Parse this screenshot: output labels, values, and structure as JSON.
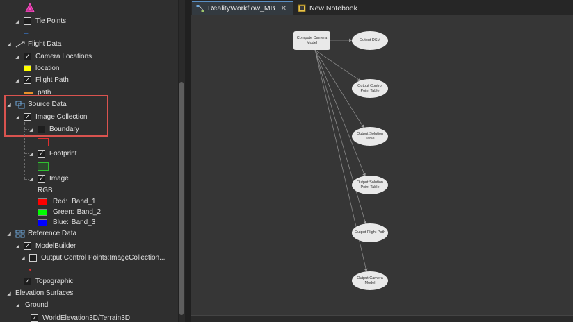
{
  "contents": {
    "tie_points": "Tie Points",
    "flight_data": "Flight Data",
    "camera_locations": "Camera Locations",
    "location": "location",
    "flight_path": "Flight Path",
    "path": "path",
    "source_data": "Source Data",
    "image_collection": "Image Collection",
    "boundary": "Boundary",
    "footprint": "Footprint",
    "image": "Image",
    "rgb": "RGB",
    "red": "Red:",
    "red_band": "Band_1",
    "green": "Green:",
    "green_band": "Band_2",
    "blue": "Blue:",
    "blue_band": "Band_3",
    "reference_data": "Reference Data",
    "model_builder": "ModelBuilder",
    "output_control_points": "Output Control Points:ImageCollection...",
    "topographic": "Topographic",
    "elevation_surfaces": "Elevation Surfaces",
    "ground": "Ground",
    "world_elevation": "WorldElevation3D/Terrain3D"
  },
  "tabs": [
    {
      "label": "RealityWorkflow_MB",
      "active": true
    },
    {
      "label": "New Notebook",
      "active": false
    }
  ],
  "model": {
    "process": "Compute Camera Model",
    "outputs": [
      "Output DSM",
      "Output Control Point Table",
      "Output Solution Table",
      "Output Solution Point Table",
      "Output Flight Path",
      "Output Camera Model"
    ]
  },
  "colors": {
    "highlight": "#d9534f",
    "tab_accent": "#5a8fc4",
    "boundary_symbol": "#e03030",
    "footprint_symbol": "#30c030",
    "red_swatch": "#ff0000",
    "green_swatch": "#00ff00",
    "blue_swatch": "#0000ff",
    "location_symbol": "#ffff00",
    "path_symbol": "#e8902a"
  }
}
